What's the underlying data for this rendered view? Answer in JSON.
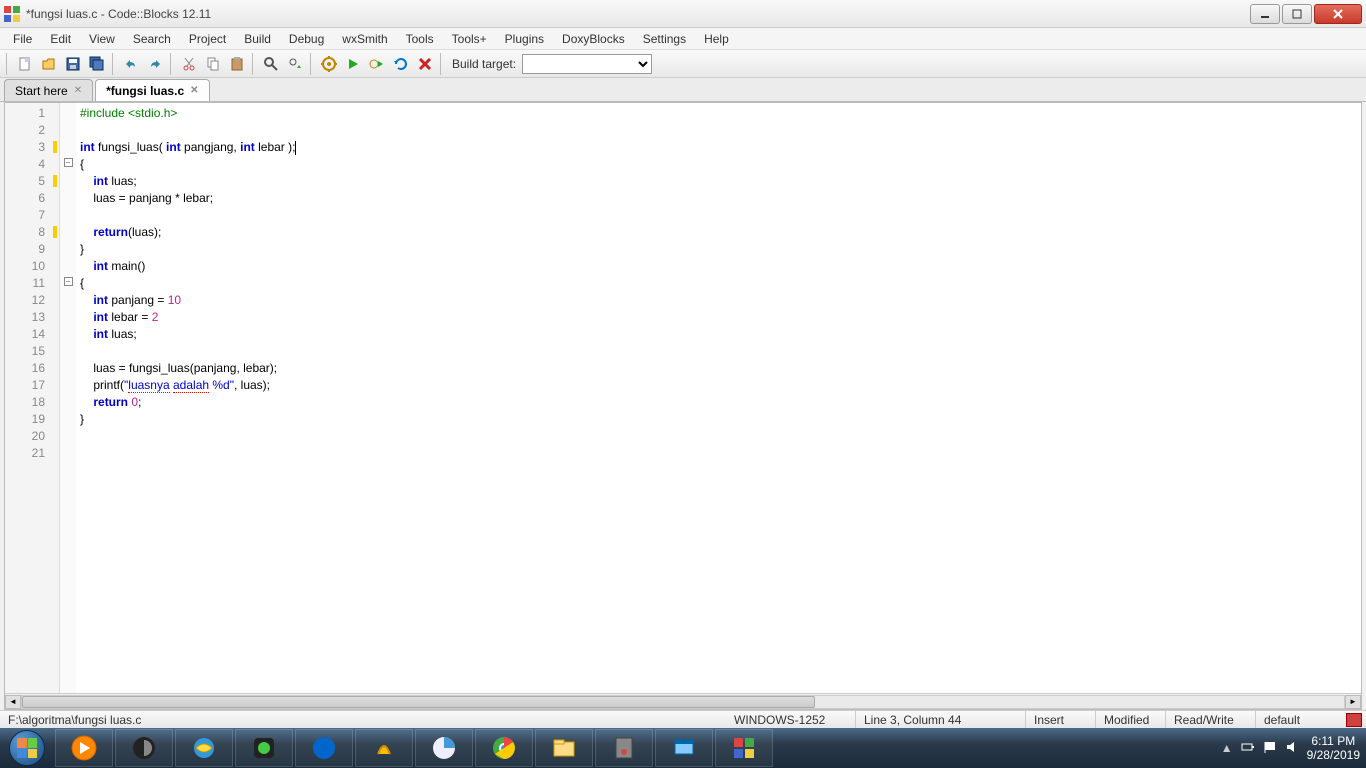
{
  "window": {
    "title": "*fungsi luas.c - Code::Blocks 12.11"
  },
  "menu": {
    "items": [
      "File",
      "Edit",
      "View",
      "Search",
      "Project",
      "Build",
      "Debug",
      "wxSmith",
      "Tools",
      "Tools+",
      "Plugins",
      "DoxyBlocks",
      "Settings",
      "Help"
    ]
  },
  "toolbar": {
    "build_target_label": "Build target:",
    "build_target_value": ""
  },
  "tabs": [
    {
      "label": "Start here",
      "active": false
    },
    {
      "label": "*fungsi luas.c",
      "active": true
    }
  ],
  "code": {
    "lines": [
      {
        "n": 1,
        "html": "<span class='pp'>#include &lt;stdio.h&gt;</span>"
      },
      {
        "n": 2,
        "html": ""
      },
      {
        "n": 3,
        "html": "<span class='kw'>int</span> fungsi_luas( <span class='kw'>int</span> pangjang, <span class='kw'>int</span> lebar );<span class='cursor'></span>",
        "marker": true
      },
      {
        "n": 4,
        "html": "{",
        "fold": "-"
      },
      {
        "n": 5,
        "html": "    <span class='kw'>int</span> luas;",
        "marker": true
      },
      {
        "n": 6,
        "html": "    luas = panjang * lebar;"
      },
      {
        "n": 7,
        "html": ""
      },
      {
        "n": 8,
        "html": "    <span class='kw'>return</span>(luas);",
        "marker": true
      },
      {
        "n": 9,
        "html": "}"
      },
      {
        "n": 10,
        "html": "    <span class='kw'>int</span> main()"
      },
      {
        "n": 11,
        "html": "{",
        "fold": "-"
      },
      {
        "n": 12,
        "html": "    <span class='kw'>int</span> panjang = <span class='num'>10</span>"
      },
      {
        "n": 13,
        "html": "    <span class='kw'>int</span> lebar = <span class='num'>2</span>"
      },
      {
        "n": 14,
        "html": "    <span class='kw'>int</span> luas;"
      },
      {
        "n": 15,
        "html": ""
      },
      {
        "n": 16,
        "html": "    luas = fungsi_luas(panjang, lebar);"
      },
      {
        "n": 17,
        "html": "    printf(<span class='str'>\"<span class='underline-red'>luasnya</span> <span class='underline-red'>adalah</span> %d\"</span>, luas);"
      },
      {
        "n": 18,
        "html": "    <span class='kw'>return</span> <span class='num'>0</span>;"
      },
      {
        "n": 19,
        "html": "}"
      },
      {
        "n": 20,
        "html": ""
      },
      {
        "n": 21,
        "html": ""
      }
    ]
  },
  "status": {
    "path": "F:\\algoritma\\fungsi luas.c",
    "encoding": "WINDOWS-1252",
    "position": "Line 3, Column 44",
    "insert": "Insert",
    "modified": "Modified",
    "readwrite": "Read/Write",
    "profile": "default"
  },
  "tray": {
    "time": "6:11 PM",
    "date": "9/28/2019"
  }
}
